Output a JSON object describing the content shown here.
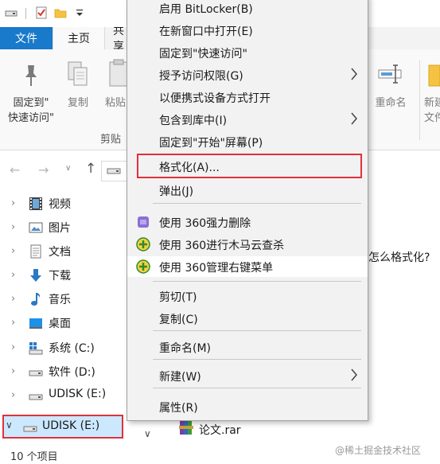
{
  "ribbon": {
    "tabs": {
      "file": "文件",
      "home": "主页",
      "share": "共享"
    },
    "pin_quick_access": "固定到\"快速访问\"",
    "pin_line1": "固定到\"",
    "pin_line2": "快速访问\"",
    "copy": "复制",
    "paste": "粘贴",
    "clipboard_group": "剪贴板",
    "clipboard_group_visible": "剪贴",
    "rename": "重命名",
    "new_folder_partial": "新建",
    "new_folder_partial2": "文件"
  },
  "navigation": {
    "items": [
      {
        "label": "视频",
        "icon": "video-folder-icon",
        "expandable": true
      },
      {
        "label": "图片",
        "icon": "pictures-folder-icon",
        "expandable": true
      },
      {
        "label": "文档",
        "icon": "documents-folder-icon",
        "expandable": true
      },
      {
        "label": "下载",
        "icon": "downloads-folder-icon",
        "expandable": true
      },
      {
        "label": "音乐",
        "icon": "music-folder-icon",
        "expandable": true
      },
      {
        "label": "桌面",
        "icon": "desktop-folder-icon",
        "expandable": true
      },
      {
        "label": "系统 (C:)",
        "icon": "system-drive-icon",
        "expandable": true
      },
      {
        "label": "软件 (D:)",
        "icon": "drive-icon",
        "expandable": true
      },
      {
        "label": "UDISK (E:)",
        "icon": "usb-drive-icon",
        "expandable": true
      },
      {
        "label": "UDISK (E:)",
        "icon": "usb-drive-icon",
        "expanded": true,
        "selected": true
      }
    ]
  },
  "status_bar": {
    "item_count": "10 个项目"
  },
  "context_menu": {
    "items": [
      {
        "label": "启用 BitLocker(B)"
      },
      {
        "label": "在新窗口中打开(E)"
      },
      {
        "label": "固定到\"快速访问\""
      },
      {
        "label": "授予访问权限(G)",
        "submenu": true
      },
      {
        "label": "以便携式设备方式打开"
      },
      {
        "label": "包含到库中(I)",
        "submenu": true
      },
      {
        "label": "固定到\"开始\"屏幕(P)"
      },
      {
        "label": "格式化(A)...",
        "highlighted_box": true
      },
      {
        "label": "弹出(J)"
      },
      {
        "label": "使用 360强力删除",
        "icon": "360-shred-icon"
      },
      {
        "label": "使用 360进行木马云查杀",
        "icon": "360-scan-icon"
      },
      {
        "label": "使用 360管理右键菜单",
        "icon": "360-menu-icon",
        "hovered": true
      },
      {
        "label": "剪切(T)"
      },
      {
        "label": "复制(C)"
      },
      {
        "label": "重命名(M)"
      },
      {
        "label": "新建(W)",
        "submenu": true
      },
      {
        "label": "属性(R)"
      }
    ]
  },
  "content": {
    "question_text": "怎么格式化?",
    "file_name": "论文.rar"
  },
  "watermark": "@稀土掘金技术社区",
  "colors": {
    "file_tab": "#1979ca",
    "highlight_border": "#e0313b",
    "selection": "#cce8ff",
    "menu_bg": "#f2f2f2"
  }
}
